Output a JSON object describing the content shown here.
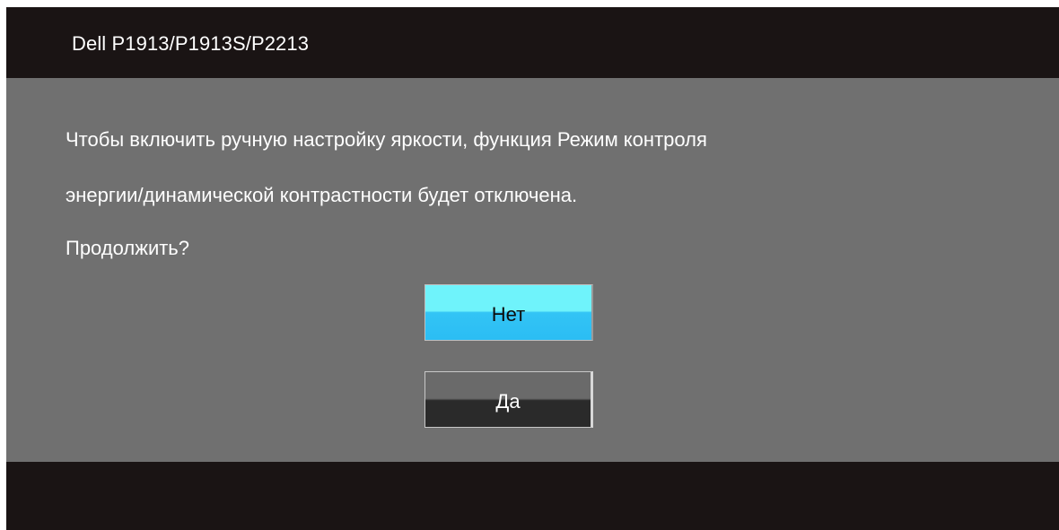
{
  "dialog": {
    "title": "Dell P1913/P1913S/P2213",
    "message_lines": [
      "Чтобы включить ручную настройку яркости, функция Режим контроля",
      "энергии/динамической контрастности будет отключена.",
      "Продолжить?"
    ],
    "buttons": {
      "no_label": "Нет",
      "yes_label": "Да"
    },
    "selected_button": "Нет"
  },
  "colors": {
    "title_bar": "#1a1414",
    "body_background": "#707070",
    "selected_button_top": "#6ff3fb",
    "selected_button_bottom": "#2bbdf3",
    "button_top": "#6a6a6a",
    "button_bottom": "#2a2a2a",
    "text": "#ffffff"
  }
}
